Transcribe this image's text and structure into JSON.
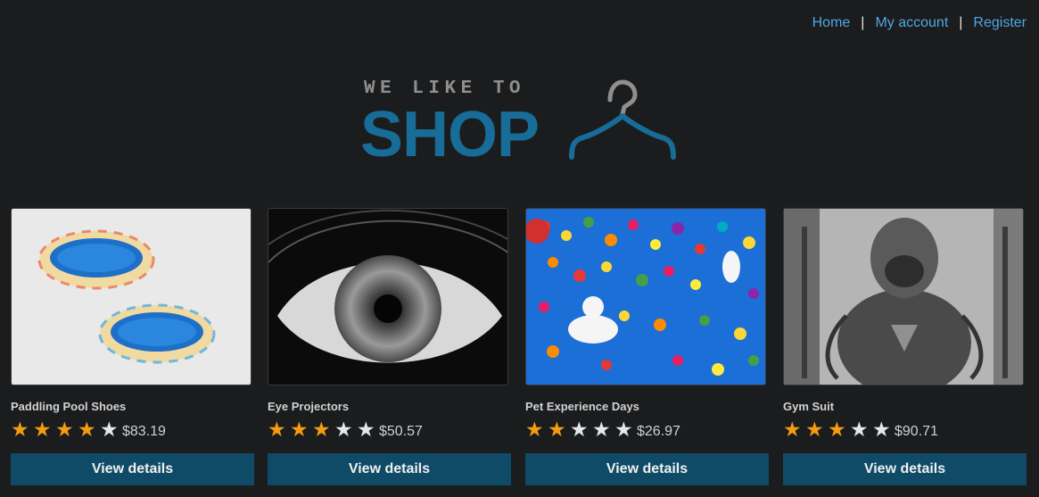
{
  "nav": {
    "home": "Home",
    "separator": "|",
    "my_account": "My account",
    "register": "Register"
  },
  "logo": {
    "tagline": "WE LIKE TO",
    "brand": "SHOP",
    "icon": "coat-hanger-icon"
  },
  "products": [
    {
      "name": "Paddling Pool Shoes",
      "rating": 4,
      "max_rating": 5,
      "price": "$83.19",
      "button": "View details",
      "image": "paddling-pool-image"
    },
    {
      "name": "Eye Projectors",
      "rating": 3,
      "max_rating": 5,
      "price": "$50.57",
      "button": "View details",
      "image": "eye-closeup-image"
    },
    {
      "name": "Pet Experience Days",
      "rating": 2,
      "max_rating": 5,
      "price": "$26.97",
      "button": "View details",
      "image": "dogs-balloons-image"
    },
    {
      "name": "Gym Suit",
      "rating": 3,
      "max_rating": 5,
      "price": "$90.71",
      "button": "View details",
      "image": "dog-muscle-gym-image"
    }
  ],
  "colors": {
    "background": "#1b1c1e",
    "link": "#4ea7e4",
    "brand": "#176c98",
    "button": "#0f4b67",
    "star_on": "#f39c12",
    "star_off": "#e4e6e8"
  }
}
